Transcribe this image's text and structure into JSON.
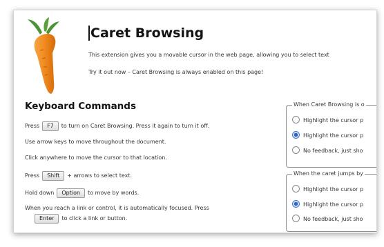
{
  "header": {
    "title": "Caret Browsing",
    "description": "This extension gives you a movable cursor in the web page, allowing you to select text",
    "tryit": "Try it out now – Caret Browsing is always enabled on this page!"
  },
  "keyboard": {
    "title": "Keyboard Commands",
    "line1": {
      "before": "Press",
      "key": "F7",
      "after": "to turn on Caret Browsing. Press it again to turn it off."
    },
    "line2": "Use arrow keys to move throughout the document.",
    "line3": "Click anywhere to move the cursor to that location.",
    "line4": {
      "before": "Press",
      "key": "Shift",
      "after": "+ arrows to select text."
    },
    "line5": {
      "before": "Hold down",
      "key": "Option",
      "after": "to move by words."
    },
    "line6": "When you reach a link or control, it is automatically focused. Press",
    "line7": {
      "key": "Enter",
      "after": "to click a link or button."
    }
  },
  "option_group_1": {
    "legend": "When Caret Browsing is o",
    "options": [
      {
        "label": "Highlight the cursor p",
        "selected": false
      },
      {
        "label": "Highlight the cursor p",
        "selected": true
      },
      {
        "label": "No feedback, just sho",
        "selected": false
      }
    ]
  },
  "option_group_2": {
    "legend": "When the caret jumps by",
    "options": [
      {
        "label": "Highlight the cursor p",
        "selected": false
      },
      {
        "label": "Highlight the cursor p",
        "selected": true
      },
      {
        "label": "No feedback, just sho",
        "selected": false
      }
    ]
  },
  "colors": {
    "radio_selected": "#2a64c8",
    "carrot_orange": "#f08a1e",
    "carrot_leaves": "#5aa03a"
  },
  "icons": {
    "logo": "carrot-logo-icon"
  }
}
